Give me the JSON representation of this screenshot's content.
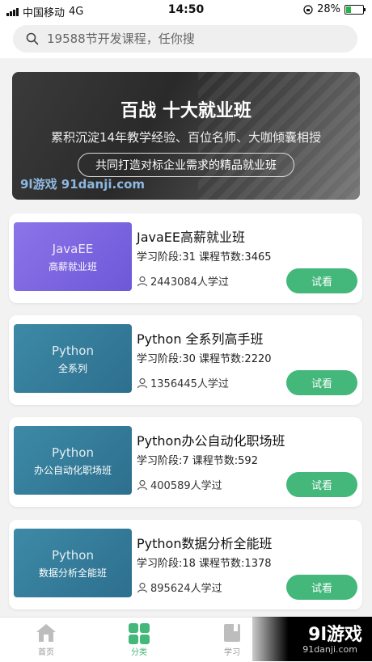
{
  "status": {
    "carrier": "中国移动",
    "network": "4G",
    "time": "14:50",
    "battery_percent": "28%",
    "battery_level": 0.28
  },
  "search": {
    "placeholder": "19588节开发课程，任你搜"
  },
  "banner": {
    "title": "百战 十大就业班",
    "subtitle": "累积沉淀14年教学经验、百位名师、大咖倾囊相授",
    "pill": "共同打造对标企业需求的精品就业班",
    "watermark": "9l游戏 91danji.com"
  },
  "courses": [
    {
      "thumb_line1": "JavaEE",
      "thumb_line2": "高薪就业班",
      "title": "JavaEE高薪就业班",
      "meta": "学习阶段:31 课程节数:3465",
      "learners": "2443084人学过",
      "button": "试看"
    },
    {
      "thumb_line1": "Python",
      "thumb_line2": "全系列",
      "title": "Python 全系列高手班",
      "meta": "学习阶段:30 课程节数:2220",
      "learners": "1356445人学过",
      "button": "试看"
    },
    {
      "thumb_line1": "Python",
      "thumb_line2": "办公自动化职场班",
      "title": "Python办公自动化职场班",
      "meta": "学习阶段:7 课程节数:592",
      "learners": "400589人学过",
      "button": "试看"
    },
    {
      "thumb_line1": "Python",
      "thumb_line2": "数据分析全能班",
      "title": "Python数据分析全能班",
      "meta": "学习阶段:18 课程节数:1378",
      "learners": "895624人学过",
      "button": "试看"
    }
  ],
  "tabs": [
    {
      "label": "首页",
      "icon": "home-icon"
    },
    {
      "label": "分类",
      "icon": "grid-icon"
    },
    {
      "label": "学习",
      "icon": "book-icon"
    }
  ],
  "watermark": {
    "big": "9l游戏",
    "small": "91danji.com"
  },
  "colors": {
    "accent": "#44b77b",
    "thumb_purple": "#7b65e0",
    "thumb_teal": "#347d9a"
  }
}
